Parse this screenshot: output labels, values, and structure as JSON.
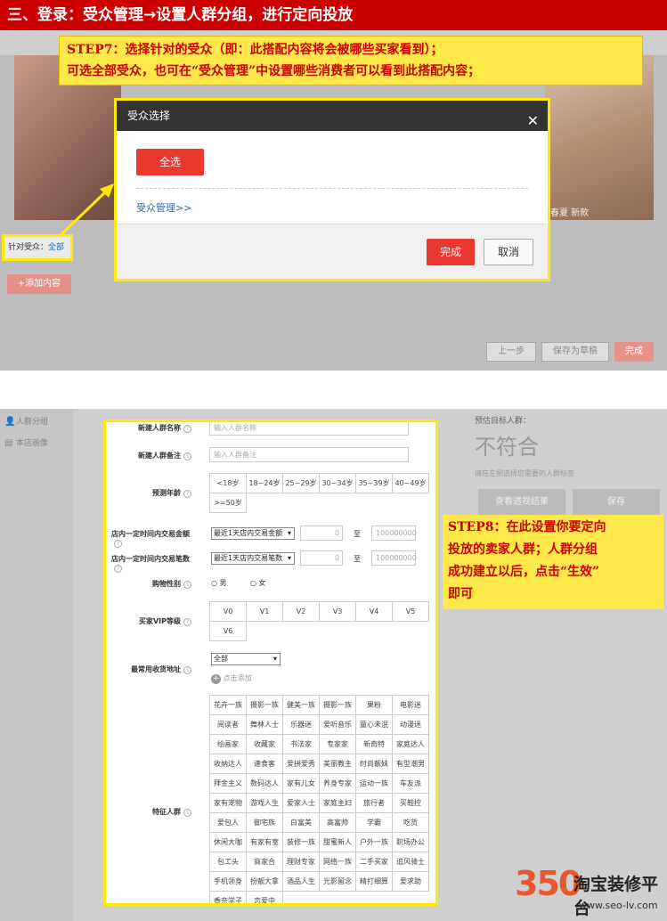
{
  "banner": "三、登录：受众管理→设置人群分组，进行定向投放",
  "step7": {
    "line1": "STEP7：选择针对的受众（即：此搭配内容将会被哪些买家看到）；",
    "line2": "可选全部受众，也可在“受众管理”中设置哪些消费者可以看到此搭配内容；"
  },
  "modal": {
    "title": "受众选择",
    "close": "✕",
    "select_all": "全选",
    "manage_link": "受众管理>>",
    "ok": "完成",
    "cancel": "取消"
  },
  "page1": {
    "right_caption": "春夏 新款",
    "target_label": "针对受众：",
    "target_value": "全部",
    "add_content": "+添加内容",
    "prev": "上一步",
    "save_draft": "保存为草稿",
    "done": "完成"
  },
  "sidebar": {
    "items": [
      {
        "label": "人群分组",
        "icon": "people-icon"
      },
      {
        "label": "本店画像",
        "icon": "profile-icon"
      }
    ]
  },
  "right_panel": {
    "est_label": "预估目标人群：",
    "result": "不符合",
    "hint": "请在左侧选择您需要的人群标签",
    "view_btn": "查看透视结果",
    "save_btn": "保存"
  },
  "form": {
    "name_label": "新建人群名称",
    "name_placeholder": "输入人群名称",
    "note_label": "新建人群备注",
    "note_placeholder": "输入人群备注",
    "age_label": "预测年龄",
    "ages": [
      "<18岁",
      "18~24岁",
      "25~29岁",
      "30~34岁",
      "35~39岁",
      "40~49岁",
      ">=50岁"
    ],
    "amount_label": "店内一定时间内交易金额",
    "amount_select": "最近1天店内交易金额",
    "amount_from": "0",
    "to": "至",
    "amount_to": "100000000",
    "count_label": "店内一定时间内交易笔数",
    "count_select": "最近1天店内交易笔数",
    "count_from": "0",
    "count_to": "100000000",
    "gender_label": "购物性别",
    "male": "男",
    "female": "女",
    "vip_label": "买家VIP等级",
    "vips": [
      "V0",
      "V1",
      "V2",
      "V3",
      "V4",
      "V5",
      "V6"
    ],
    "addr_label": "最常用收货地址",
    "addr_select": "全部",
    "addr_add": "点击添加",
    "tags_label": "特征人群",
    "tags": [
      "花卉一族",
      "摄影一族",
      "健美一族",
      "摄影一族",
      "果粉",
      "电影迷",
      "阅读者",
      "舞林人士",
      "乐器迷",
      "爱听音乐",
      "童心未泯",
      "动漫迷",
      "绘画家",
      "收藏家",
      "书法家",
      "专家家",
      "新奇特",
      "家庭达人",
      "收纳达人",
      "速食客",
      "爱拼爱秀",
      "美丽教主",
      "时尚靓妹",
      "有型潮男",
      "拜金主义",
      "数码达人",
      "家有儿女",
      "养身专家",
      "运动一族",
      "车友派",
      "家有宠物",
      "游戏人生",
      "爱家人士",
      "家庭主妇",
      "旅行者",
      "买鞋控",
      "爱包人",
      "御宅族",
      "白富美",
      "高富帅",
      "学霸",
      "吃货",
      "休闲大咖",
      "有家有室",
      "装修一族",
      "甜蜜新人",
      "户外一族",
      "职场办公",
      "包工头",
      "商家合",
      "理财专家",
      "网络一族",
      "二手买家",
      "追风骑士",
      "手机领身",
      "扮靓大拿",
      "酒品人生",
      "光影留念",
      "精打细算",
      "爱求助",
      "香奈学子",
      "恋爱中"
    ]
  },
  "step8": {
    "line1": "STEP8：在此设置你要定向",
    "line2": "投放的卖家人群；人群分组",
    "line3": "成功建立以后，点击“生效”",
    "line4": "即可"
  },
  "logo": {
    "num": "350",
    "name": "淘宝装修平台",
    "url": "www.seo-lv.com"
  }
}
